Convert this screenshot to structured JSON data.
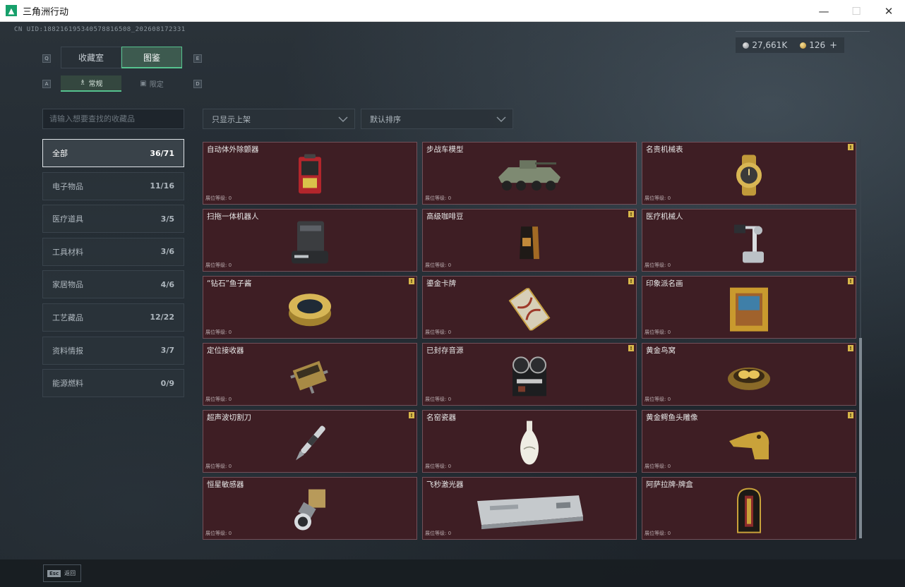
{
  "window": {
    "title": "三角洲行动"
  },
  "header": {
    "uid": "CN UID:18821619534057881650​8_2026081723​31",
    "silver": "27,661K",
    "gold": "126",
    "plus": "+"
  },
  "tabs": {
    "keys": {
      "left": "Q",
      "right": "E",
      "sub_left": "A",
      "sub_right": "D"
    },
    "main": [
      {
        "label": "收藏室"
      },
      {
        "label": "图鉴"
      }
    ],
    "sub": [
      {
        "label": "常规"
      },
      {
        "label": "限定"
      }
    ]
  },
  "search": {
    "placeholder": "请输入想要查找的收藏品"
  },
  "filters": {
    "shelf": "只显示上架",
    "sort": "默认排序"
  },
  "categories": [
    {
      "label": "全部",
      "count": "36/71"
    },
    {
      "label": "电子物品",
      "count": "11/16"
    },
    {
      "label": "医疗道具",
      "count": "3/5"
    },
    {
      "label": "工具材料",
      "count": "3/6"
    },
    {
      "label": "家居物品",
      "count": "4/6"
    },
    {
      "label": "工艺藏品",
      "count": "12/22"
    },
    {
      "label": "资料情报",
      "count": "3/7"
    },
    {
      "label": "能源燃料",
      "count": "0/9"
    }
  ],
  "items": [
    {
      "name": "自动体外除颤器",
      "level": "展位等级: 0",
      "flag": ""
    },
    {
      "name": "步战车模型",
      "level": "展位等级: 0",
      "flag": ""
    },
    {
      "name": "名贵机械表",
      "level": "展位等级: 0",
      "flag": "!"
    },
    {
      "name": "扫拖一体机器人",
      "level": "展位等级: 0",
      "flag": ""
    },
    {
      "name": "高级咖啡豆",
      "level": "展位等级: 0",
      "flag": "!"
    },
    {
      "name": "医疗机械人",
      "level": "展位等级: 0",
      "flag": ""
    },
    {
      "name": "“钻石”鱼子酱",
      "level": "展位等级: 0",
      "flag": "!"
    },
    {
      "name": "鎏金卡牌",
      "level": "展位等级: 0",
      "flag": "!"
    },
    {
      "name": "印象派名画",
      "level": "展位等级: 0",
      "flag": "!"
    },
    {
      "name": "定位接收器",
      "level": "展位等级: 0",
      "flag": ""
    },
    {
      "name": "已封存音源",
      "level": "展位等级: 0",
      "flag": "!"
    },
    {
      "name": "黄金鸟窝",
      "level": "展位等级: 0",
      "flag": "!"
    },
    {
      "name": "超声波切割刀",
      "level": "展位等级: 0",
      "flag": "!"
    },
    {
      "name": "名窑瓷器",
      "level": "展位等级: 0",
      "flag": ""
    },
    {
      "name": "黄金鳄鱼头雕像",
      "level": "展位等级: 0",
      "flag": "!"
    },
    {
      "name": "恒星敏感器",
      "level": "展位等级: 0",
      "flag": ""
    },
    {
      "name": "飞秒激光器",
      "level": "展位等级: 0",
      "flag": ""
    },
    {
      "name": "阿萨拉牌-牌盒",
      "level": "展位等级: 0",
      "flag": ""
    }
  ],
  "footer": {
    "esc": "Esc",
    "back": "返回"
  }
}
